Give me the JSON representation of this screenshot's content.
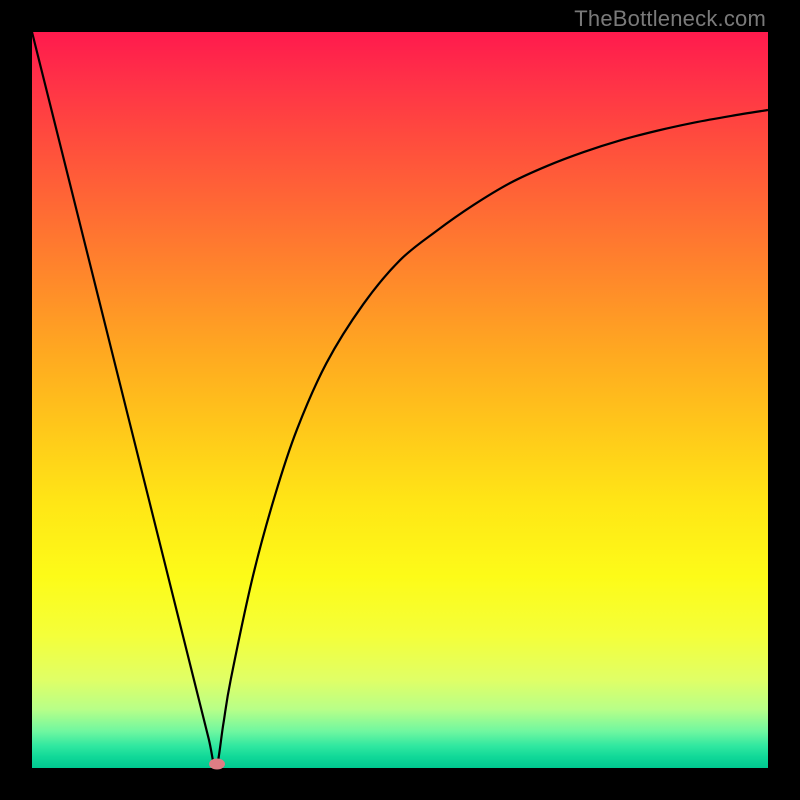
{
  "watermark": "TheBottleneck.com",
  "colors": {
    "frame": "#000000",
    "curve_stroke": "#000000",
    "marker_fill": "#de7d84",
    "gradient_top": "#ff1a4d",
    "gradient_bottom": "#00c890"
  },
  "chart_data": {
    "type": "line",
    "title": "",
    "xlabel": "",
    "ylabel": "",
    "xlim": [
      0,
      100
    ],
    "ylim": [
      0,
      100
    ],
    "x": [
      0,
      2,
      4,
      6,
      8,
      10,
      12,
      14,
      16,
      18,
      20,
      22,
      24,
      25,
      26,
      27,
      30,
      33,
      36,
      40,
      45,
      50,
      55,
      60,
      65,
      70,
      75,
      80,
      85,
      90,
      95,
      100
    ],
    "values": [
      100,
      92,
      84,
      76,
      68,
      60,
      52,
      44,
      36,
      28,
      20,
      12,
      4,
      0,
      6,
      12,
      26,
      37,
      46,
      55,
      63,
      69,
      73,
      76.5,
      79.5,
      81.8,
      83.7,
      85.3,
      86.6,
      87.7,
      88.6,
      89.4
    ],
    "marker": {
      "x": 25.2,
      "y": 0.5
    },
    "annotations": [],
    "legend": []
  }
}
